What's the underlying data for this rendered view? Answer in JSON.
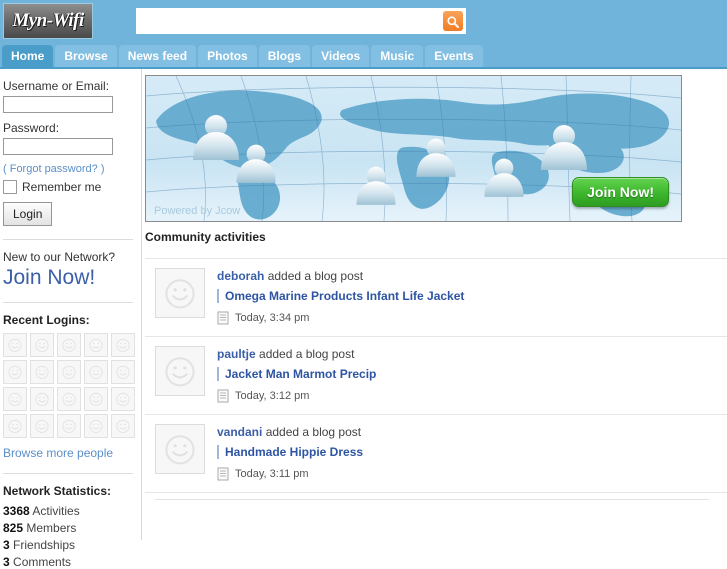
{
  "header": {
    "logo_text": "Myn-Wifi",
    "search": {
      "value": "",
      "placeholder": "",
      "icon": "search-icon",
      "button_color": "#f07c23"
    }
  },
  "nav": {
    "active": "Home",
    "items": [
      {
        "label": "Home"
      },
      {
        "label": "Browse"
      },
      {
        "label": "News feed"
      },
      {
        "label": "Photos"
      },
      {
        "label": "Blogs"
      },
      {
        "label": "Videos"
      },
      {
        "label": "Music"
      },
      {
        "label": "Events"
      }
    ]
  },
  "sidebar": {
    "login": {
      "username_label": "Username or Email:",
      "username_value": "",
      "username_placeholder": "",
      "password_label": "Password:",
      "password_value": "",
      "password_placeholder": "",
      "forgot_label": "( Forgot password? )",
      "remember_label": "Remember me",
      "remember_checked": false,
      "login_button": "Login"
    },
    "join": {
      "lead": "New to our Network?",
      "cta": "Join Now!"
    },
    "recent_logins": {
      "heading": "Recent Logins:",
      "avatar_count": 20,
      "browse_more": "Browse more people"
    },
    "network_statistics": {
      "heading": "Network Statistics:",
      "rows": [
        {
          "value": "3368",
          "label": "Activities"
        },
        {
          "value": "825",
          "label": "Members"
        },
        {
          "value": "3",
          "label": "Friendships"
        },
        {
          "value": "3",
          "label": "Comments"
        }
      ]
    }
  },
  "main": {
    "banner": {
      "powered_by": "Powered by Jcow",
      "join_button": "Join Now!",
      "join_button_color": "#3cb62c"
    },
    "section_title": "Community activities",
    "activities": [
      {
        "user": "deborah",
        "action": "added a blog post",
        "title": "Omega Marine Products Infant Life Jacket",
        "icon": "document-icon",
        "timestamp": "Today, 3:34 pm"
      },
      {
        "user": "paultje",
        "action": "added a blog post",
        "title": "Jacket Man Marmot Precip",
        "icon": "document-icon",
        "timestamp": "Today, 3:12 pm"
      },
      {
        "user": "vandani",
        "action": "added a blog post",
        "title": "Handmade Hippie Dress",
        "icon": "document-icon",
        "timestamp": "Today, 3:11 pm"
      }
    ]
  }
}
